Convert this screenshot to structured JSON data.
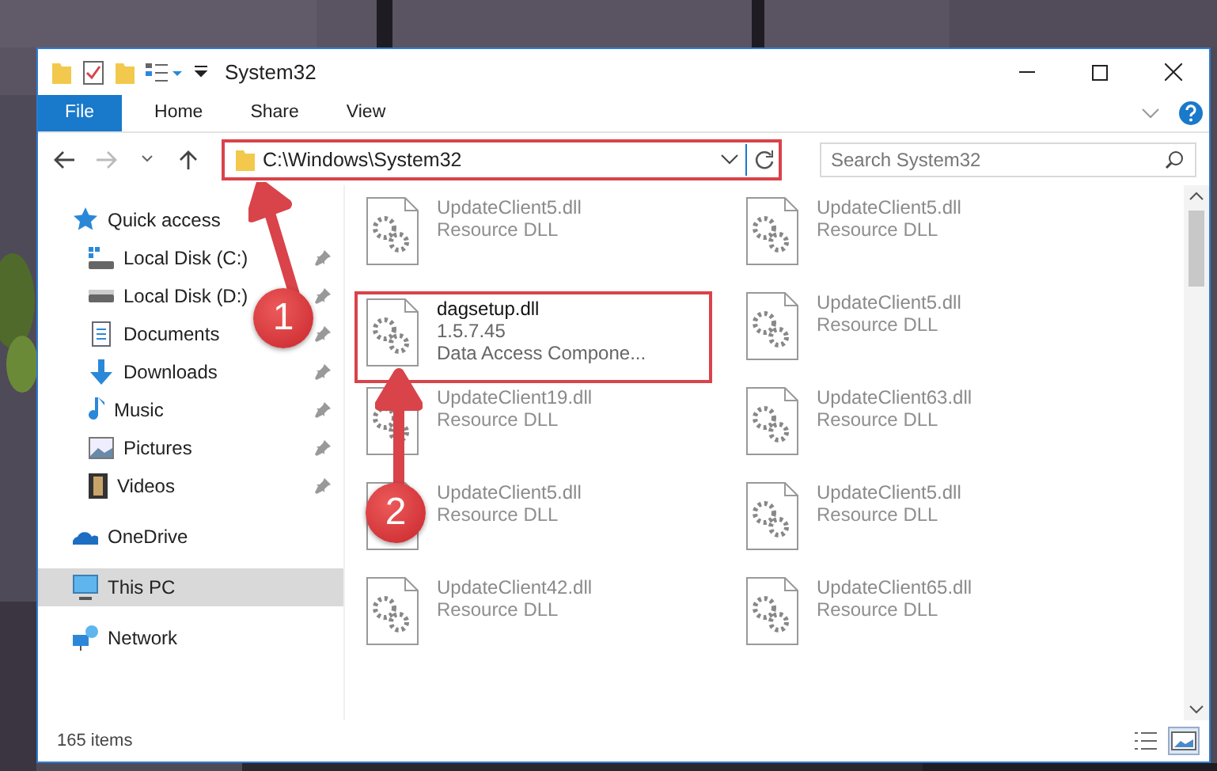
{
  "window": {
    "title": "System32"
  },
  "ribbon": {
    "tabs": [
      {
        "label": "File",
        "kind": "file",
        "selected": false
      },
      {
        "label": "Home",
        "kind": "tab",
        "selected": false
      },
      {
        "label": "Share",
        "kind": "tab",
        "selected": false
      },
      {
        "label": "View",
        "kind": "tab",
        "selected": false
      }
    ]
  },
  "address_bar": {
    "path": "C:\\Windows\\System32",
    "highlighted": true
  },
  "search": {
    "placeholder": "Search System32"
  },
  "sidebar": {
    "items": [
      {
        "label": "Quick access",
        "kind": "star",
        "selected": false,
        "pinned": false,
        "children": [
          {
            "label": "Local Disk (C:)",
            "kind": "drive-win",
            "selected": false,
            "pinned": true
          },
          {
            "label": "Local Disk (D:)",
            "kind": "drive",
            "selected": false,
            "pinned": true
          },
          {
            "label": "Documents",
            "kind": "doc",
            "selected": false,
            "pinned": true
          },
          {
            "label": "Downloads",
            "kind": "down",
            "selected": false,
            "pinned": true
          },
          {
            "label": "Music",
            "kind": "music",
            "selected": false,
            "pinned": true
          },
          {
            "label": "Pictures",
            "kind": "pictures",
            "selected": false,
            "pinned": true
          },
          {
            "label": "Videos",
            "kind": "videos",
            "selected": false,
            "pinned": true
          }
        ]
      },
      {
        "label": "OneDrive",
        "kind": "cloud",
        "selected": false,
        "pinned": false
      },
      {
        "label": "This PC",
        "kind": "pc",
        "selected": true,
        "pinned": false
      },
      {
        "label": "Network",
        "kind": "network",
        "selected": false,
        "pinned": false
      }
    ]
  },
  "files": [
    {
      "name": "UpdateClient5.dll",
      "lines": [
        "Resource DLL"
      ],
      "faded": true,
      "highlighted": false
    },
    {
      "name": "UpdateClient5.dll",
      "lines": [
        "Resource DLL"
      ],
      "faded": true,
      "highlighted": false
    },
    {
      "name": "dagsetup.dll",
      "lines": [
        "1.5.7.45",
        "Data Access Compone..."
      ],
      "faded": false,
      "highlighted": true
    },
    {
      "name": "UpdateClient5.dll",
      "lines": [
        "Resource DLL"
      ],
      "faded": true,
      "highlighted": false
    },
    {
      "name": "UpdateClient19.dll",
      "lines": [
        "Resource DLL"
      ],
      "faded": true,
      "highlighted": false
    },
    {
      "name": "UpdateClient63.dll",
      "lines": [
        "Resource DLL"
      ],
      "faded": true,
      "highlighted": false
    },
    {
      "name": "UpdateClient5.dll",
      "lines": [
        "Resource DLL"
      ],
      "faded": true,
      "highlighted": false
    },
    {
      "name": "UpdateClient5.dll",
      "lines": [
        "Resource DLL"
      ],
      "faded": true,
      "highlighted": false
    },
    {
      "name": "UpdateClient42.dll",
      "lines": [
        "Resource DLL"
      ],
      "faded": true,
      "highlighted": false
    },
    {
      "name": "UpdateClient65.dll",
      "lines": [
        "Resource DLL"
      ],
      "faded": true,
      "highlighted": false
    }
  ],
  "status_bar": {
    "count": "165 items",
    "views": [
      {
        "kind": "details",
        "selected": false
      },
      {
        "kind": "large-icons",
        "selected": true
      }
    ]
  },
  "annotations": [
    {
      "label": "1"
    },
    {
      "label": "2"
    }
  ]
}
